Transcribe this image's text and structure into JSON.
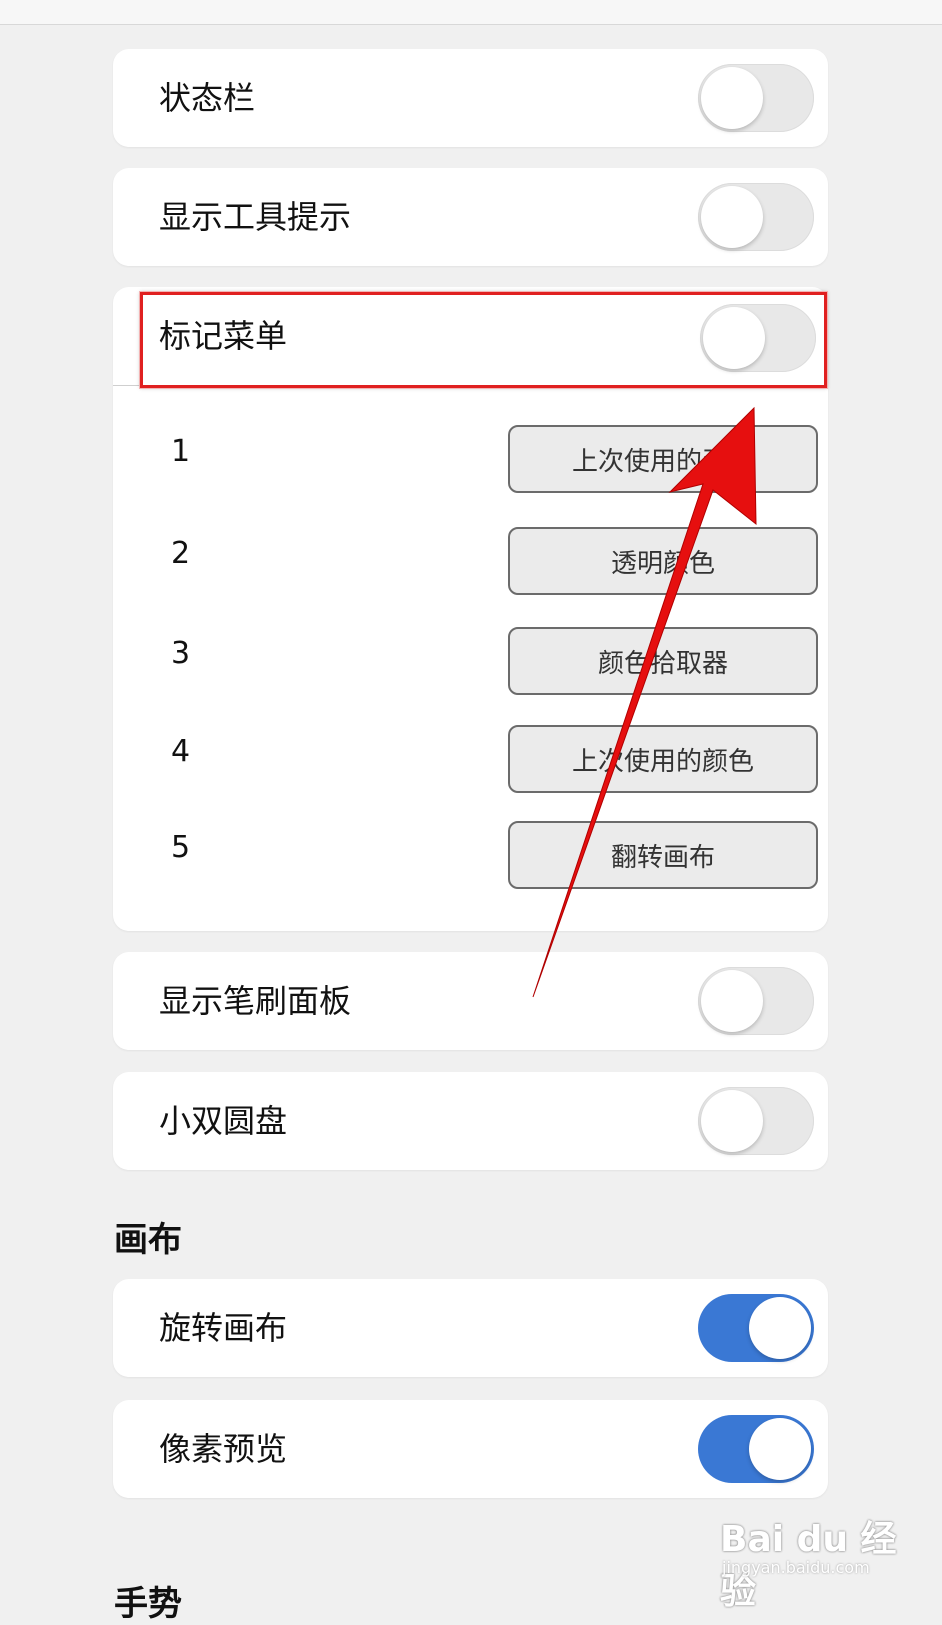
{
  "toggles_top": [
    {
      "label": "状态栏",
      "on": false
    },
    {
      "label": "显示工具提示",
      "on": false
    }
  ],
  "mark_menu": {
    "label": "标记菜单",
    "on": false,
    "slots": [
      {
        "num": "1",
        "value": "上次使用的画笔"
      },
      {
        "num": "2",
        "value": "透明颜色"
      },
      {
        "num": "3",
        "value": "颜色拾取器"
      },
      {
        "num": "4",
        "value": "上次使用的颜色"
      },
      {
        "num": "5",
        "value": "翻转画布"
      }
    ]
  },
  "toggles_mid": [
    {
      "label": "显示笔刷面板",
      "on": false
    },
    {
      "label": "小双圆盘",
      "on": false
    }
  ],
  "canvas_section": {
    "title": "画布",
    "items": [
      {
        "label": "旋转画布",
        "on": true
      },
      {
        "label": "像素预览",
        "on": true
      }
    ]
  },
  "gesture_section": {
    "title": "手势"
  },
  "colors": {
    "accent": "#3a78d4",
    "annotation": "#e02020",
    "background": "#f0f0f0"
  },
  "watermark": {
    "logo": "Bai du 经验",
    "sub": "jingyan.baidu.com"
  }
}
